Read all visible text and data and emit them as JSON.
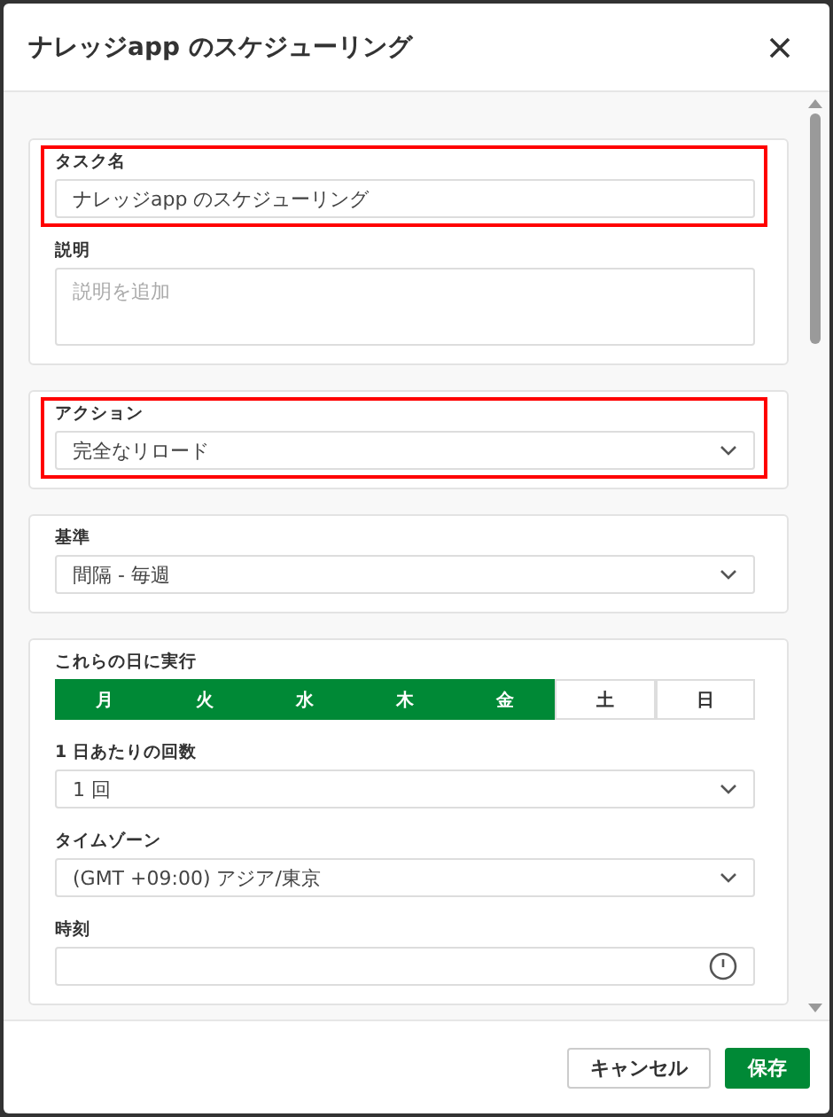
{
  "dialog": {
    "title": "ナレッジapp のスケジューリング"
  },
  "sections": [
    {
      "fields": [
        {
          "kind": "text",
          "label": "タスク名",
          "value": "ナレッジapp のスケジューリング",
          "highlighted": true
        },
        {
          "kind": "textarea",
          "label": "説明",
          "placeholder": "説明を追加",
          "highlighted": false
        }
      ]
    },
    {
      "fields": [
        {
          "kind": "select",
          "label": "アクション",
          "value": "完全なリロード",
          "highlighted": true
        }
      ]
    },
    {
      "fields": [
        {
          "kind": "select",
          "label": "基準",
          "value": "間隔 - 毎週",
          "highlighted": false
        }
      ]
    },
    {
      "fields": [
        {
          "kind": "days",
          "label": "これらの日に実行",
          "highlighted": false,
          "days": [
            {
              "label": "月",
              "selected": true
            },
            {
              "label": "火",
              "selected": true
            },
            {
              "label": "水",
              "selected": true
            },
            {
              "label": "木",
              "selected": true
            },
            {
              "label": "金",
              "selected": true
            },
            {
              "label": "土",
              "selected": false
            },
            {
              "label": "日",
              "selected": false
            }
          ]
        },
        {
          "kind": "select",
          "label": "1 日あたりの回数",
          "value": "1 回",
          "highlighted": false
        },
        {
          "kind": "select",
          "label": "タイムゾーン",
          "value": "(GMT +09:00) アジア/東京",
          "highlighted": false
        },
        {
          "kind": "time",
          "label": "時刻",
          "highlighted": false
        }
      ]
    }
  ],
  "buttons": [
    {
      "label": "キャンセル",
      "kind": "secondary"
    },
    {
      "label": "保存",
      "kind": "primary"
    }
  ]
}
